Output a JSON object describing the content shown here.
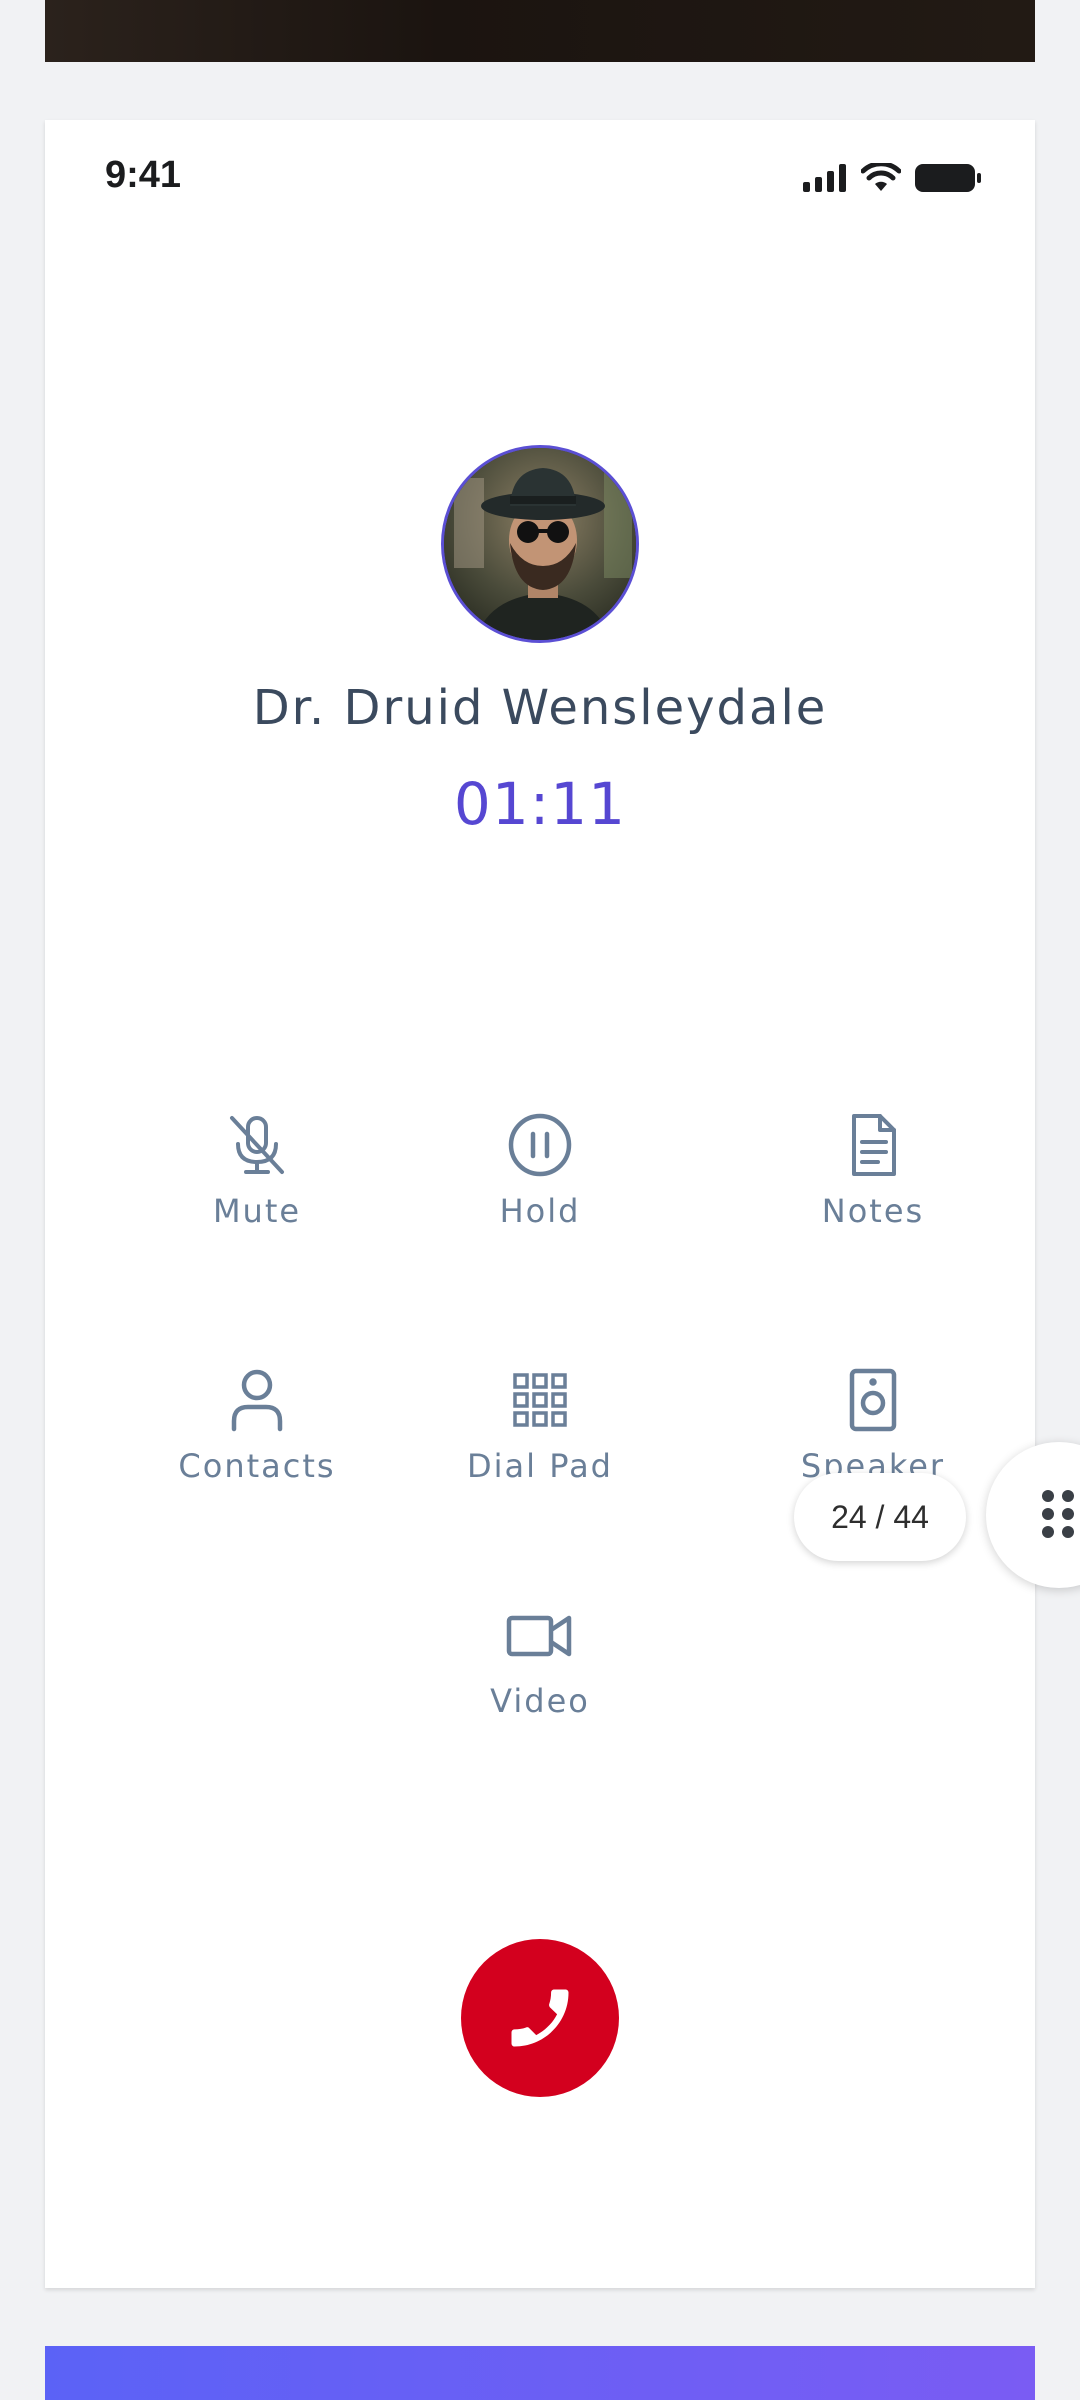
{
  "status_bar": {
    "time": "9:41"
  },
  "call": {
    "caller_name": "Dr. Druid Wensleydale",
    "duration": "01:11"
  },
  "actions": {
    "mute": "Mute",
    "hold": "Hold",
    "notes": "Notes",
    "contacts": "Contacts",
    "dial_pad": "Dial Pad",
    "speaker": "Speaker",
    "video": "Video"
  },
  "pager": {
    "label": "24 / 44"
  },
  "colors": {
    "accent": "#5647d2",
    "end_call": "#d3001e",
    "icon": "#6a7f98",
    "name_text": "#3b4a5e"
  },
  "icons": {
    "mute": "mic-off-icon",
    "hold": "pause-circle-icon",
    "notes": "document-icon",
    "contacts": "user-icon",
    "dial_pad": "keypad-icon",
    "speaker": "speaker-icon",
    "video": "video-camera-icon",
    "end_call": "phone-icon",
    "grip": "drag-handle-icon"
  }
}
